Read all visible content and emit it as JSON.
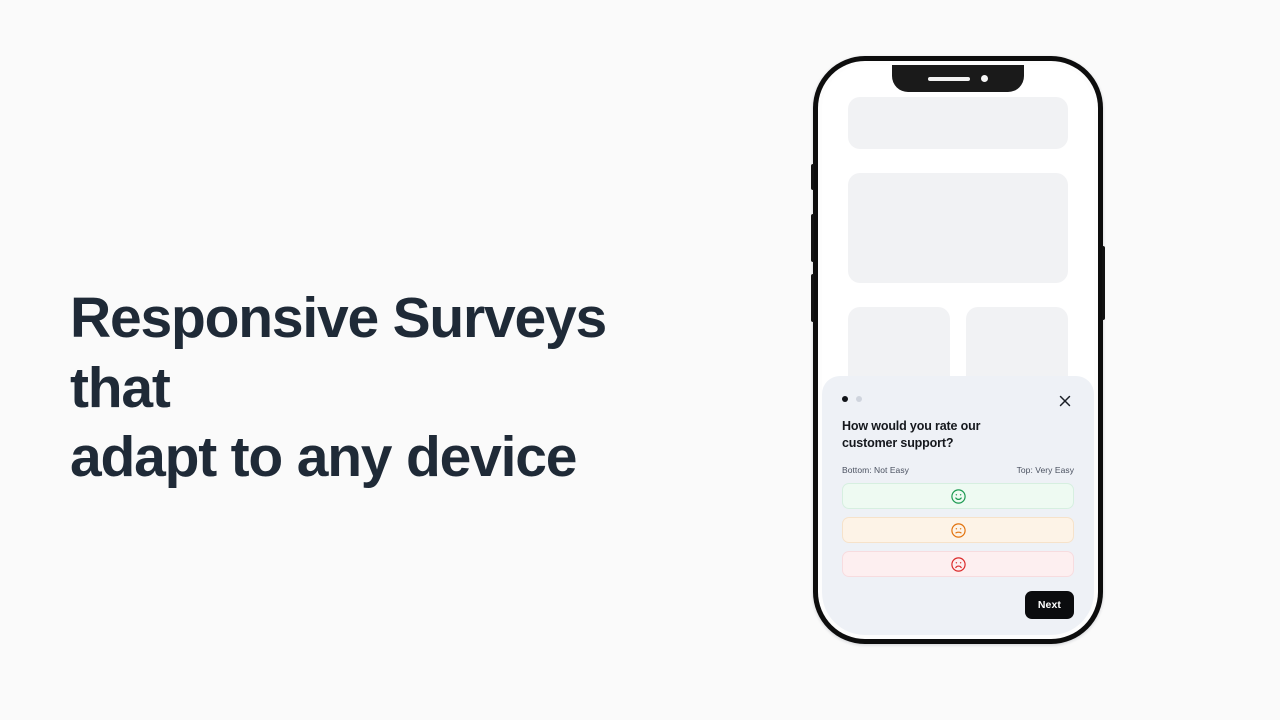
{
  "page": {
    "background_color": "#fafafa"
  },
  "hero": {
    "headline_line1": "Responsive Surveys that",
    "headline_line2": "adapt to any device",
    "text_color": "#1f2a37"
  },
  "phone": {
    "device_name": "smartphone-mockup",
    "frame_color": "#0d0d0d",
    "screen_background": "#ffffff",
    "notch": {
      "speaker_name": "speaker-slot",
      "camera_name": "front-camera-dot"
    },
    "hardware_buttons": [
      {
        "name": "silent-switch"
      },
      {
        "name": "volume-up-button"
      },
      {
        "name": "volume-down-button"
      },
      {
        "name": "power-button"
      }
    ],
    "skeleton_placeholders": [
      {
        "name": "skeleton-bar"
      },
      {
        "name": "skeleton-block"
      },
      {
        "name": "skeleton-tile-left"
      },
      {
        "name": "skeleton-tile-right"
      }
    ]
  },
  "survey": {
    "card_background": "#eef1f6",
    "progress_dots": [
      {
        "state": "active"
      },
      {
        "state": "inactive"
      }
    ],
    "close_icon": "close-icon",
    "question": "How would you rate our customer support?",
    "scale_label_low": "Bottom: Not Easy",
    "scale_label_high": "Top: Very Easy",
    "options": [
      {
        "icon": "smiley-happy-icon",
        "sentiment": "good",
        "color": "#1d9a52"
      },
      {
        "icon": "smiley-neutral-icon",
        "sentiment": "neutral",
        "color": "#e2730f"
      },
      {
        "icon": "smiley-sad-icon",
        "sentiment": "bad",
        "color": "#db2b2b"
      }
    ],
    "next_label": "Next",
    "next_button_color": "#0b0c0e"
  }
}
